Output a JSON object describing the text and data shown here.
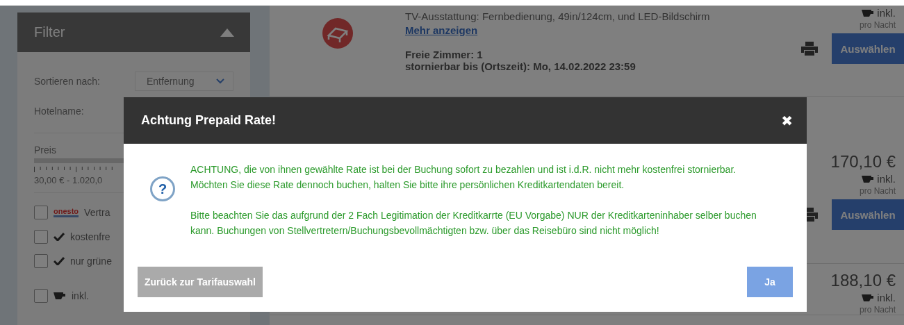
{
  "sidebar": {
    "title": "Filter",
    "sort": {
      "label": "Sortieren nach:",
      "value": "Entfernung"
    },
    "hotel_name": {
      "label": "Hotelname:"
    },
    "price": {
      "label": "Preis",
      "range": "30,00 € -  1.020,0"
    },
    "checkboxes": [
      {
        "kind": "logo",
        "logo": "onesto",
        "label": "Vertra",
        "checked": false
      },
      {
        "kind": "tick",
        "label": "kostenfre",
        "checked": false
      },
      {
        "kind": "tick",
        "label": "nur grüne",
        "checked": false
      },
      {
        "kind": "cup",
        "label": "inkl.",
        "checked": false
      }
    ]
  },
  "offers": [
    {
      "details": "TV-Ausstattung: Fernbedienung, 49in/124cm, und LED-Bildschirm",
      "link": "Mehr anzeigen",
      "rooms": "Freie Zimmer: 1",
      "cancel": "stornierbar bis (Ortszeit): Mo, 14.02.2022 23:59",
      "breakfast": "inkl.",
      "per_night": "pro Nacht",
      "button": "Auswählen"
    },
    {
      "price": "170,10 €",
      "breakfast": "inkl.",
      "per_night": "pro Nacht",
      "button": "Auswählen"
    },
    {
      "price": "188,10 €",
      "breakfast": "inkl.",
      "per_night": "pro Nacht"
    }
  ],
  "dialog": {
    "title": "Achtung Prepaid Rate!",
    "close": "✖",
    "icon": "?",
    "paragraphs": [
      "ACHTUNG, die von ihnen gewählte Rate ist bei der Buchung sofort zu bezahlen und ist i.d.R. nicht mehr kostenfrei stornierbar. Möchten Sie diese Rate dennoch buchen, halten Sie bitte ihre persönlichen Kreditkartendaten bereit.",
      "Bitte beachten Sie das aufgrund der 2 Fach Legitimation der Kreditkarrte (EU Vorgabe) NUR der Kreditkarteninhaber selber buchen kann. Buchungen von Stellvertretern/Buchungsbevollmächtigten bzw. über das Reisebüro sind nicht möglich!"
    ],
    "buttons": [
      {
        "label": "Zurück zur Tarifauswahl",
        "kind": "secondary"
      },
      {
        "label": "Ja",
        "kind": "primary"
      }
    ]
  }
}
